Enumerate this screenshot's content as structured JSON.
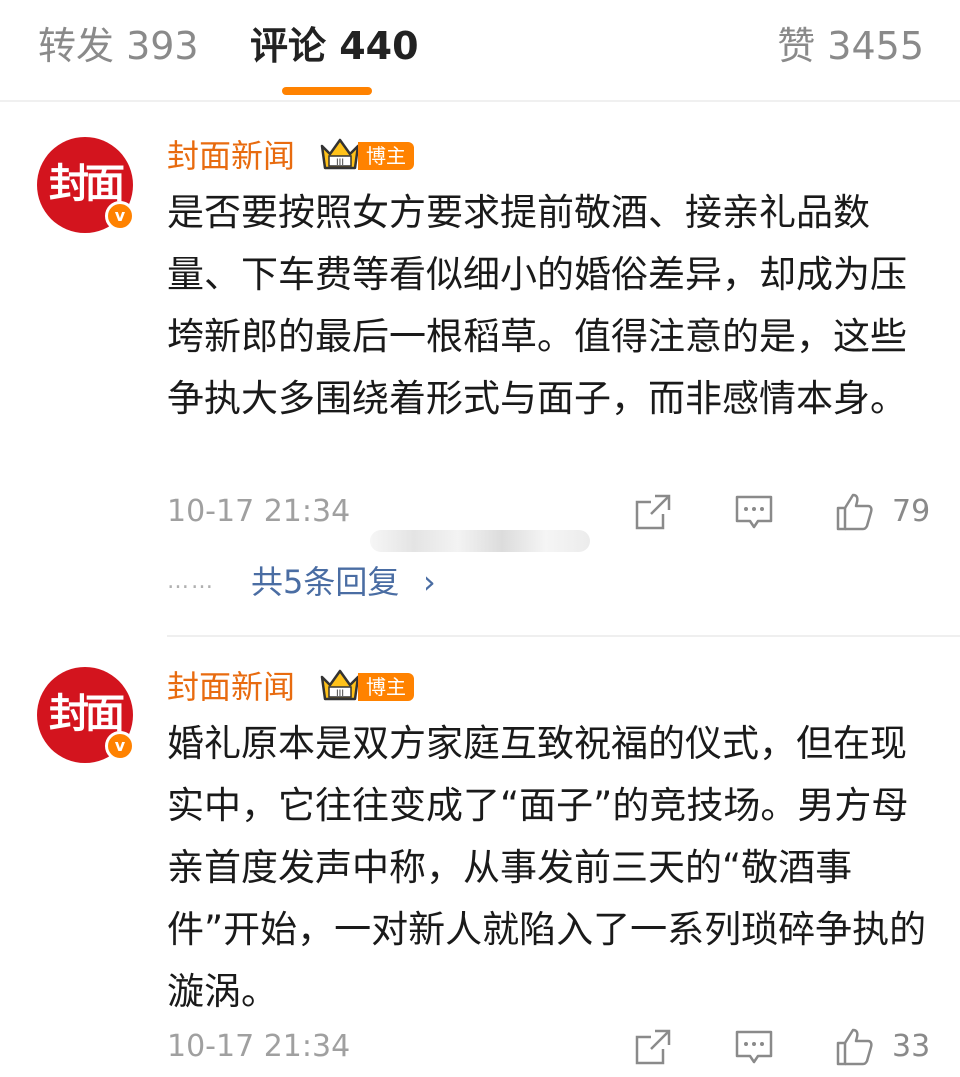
{
  "tabs": {
    "repost": "转发 393",
    "comment": "评论 440",
    "like": "赞 3455"
  },
  "colors": {
    "accent": "#ff8200",
    "username": "#e86b0f",
    "avatar_bg": "#d3141e",
    "link": "#4a6da3"
  },
  "comments": [
    {
      "avatar_text": "封面",
      "verified_mark": "v",
      "username": "封面新闻",
      "badge": "博主",
      "badge_icon": "crown-icon",
      "content": "是否要按照女方要求提前敬酒、接亲礼品数量、下车费等看似细小的婚俗差异，却成为压垮新郎的最后一根稻草。值得注意的是，这些争执大多围绕着形式与面子，而非感情本身。",
      "time": "10-17 21:34",
      "likes": "79",
      "replies_dots": "……",
      "replies_link": "共5条回复",
      "replies_chevron": "›"
    },
    {
      "avatar_text": "封面",
      "verified_mark": "v",
      "username": "封面新闻",
      "badge": "博主",
      "badge_icon": "crown-icon",
      "content": "婚礼原本是双方家庭互致祝福的仪式，但在现实中，它往往变成了“面子”的竞技场。男方母亲首度发声中称，从事发前三天的“敬酒事件”开始，一对新人就陷入了一系列琐碎争执的漩涡。",
      "time": "10-17 21:34",
      "likes": "33"
    }
  ]
}
